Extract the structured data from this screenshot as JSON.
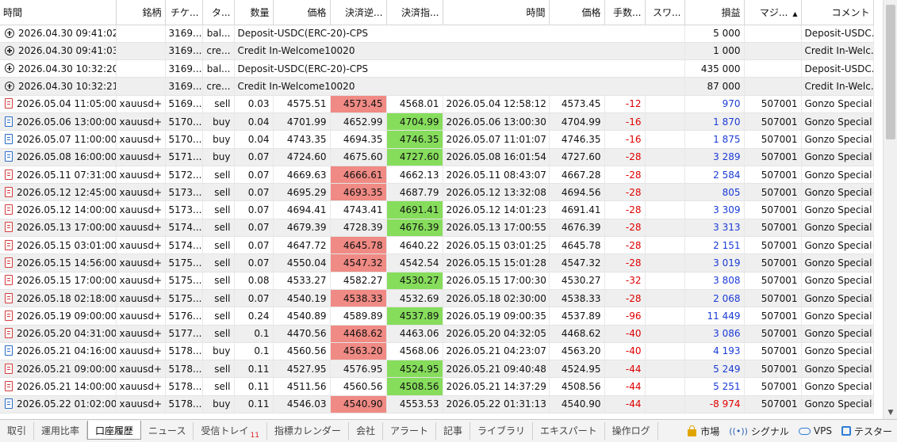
{
  "columns": [
    "時間",
    "銘柄",
    "チケ...",
    "タ...",
    "数量",
    "価格",
    "決済逆...",
    "決済指...",
    "時間",
    "価格",
    "手数...",
    "スワ...",
    "損益",
    "マジ...",
    "コメント"
  ],
  "sort_arrow": "▲",
  "rows": [
    {
      "icon": "plus",
      "time": "2026.04.30 09:41:02",
      "symbol": "",
      "ticket": "3169...",
      "type": "bal...",
      "volume": "Deposit-USDC(ERC-20)-CPS",
      "price": "",
      "sl": "",
      "tp": "",
      "time2": "",
      "price2": "",
      "fee": "",
      "swap": "",
      "profit": "5 000",
      "magic": "",
      "comment": "Deposit-USDC..."
    },
    {
      "icon": "plus",
      "time": "2026.04.30 09:41:03",
      "symbol": "",
      "ticket": "3169...",
      "type": "cre...",
      "volume": "Credit In-Welcome10020",
      "price": "",
      "sl": "",
      "tp": "",
      "time2": "",
      "price2": "",
      "fee": "",
      "swap": "",
      "profit": "1 000",
      "magic": "",
      "comment": "Credit In-Welc..."
    },
    {
      "icon": "plus",
      "time": "2026.04.30 10:32:20",
      "symbol": "",
      "ticket": "3169...",
      "type": "bal...",
      "volume": "Deposit-USDC(ERC-20)-CPS",
      "price": "",
      "sl": "",
      "tp": "",
      "time2": "",
      "price2": "",
      "fee": "",
      "swap": "",
      "profit": "435 000",
      "magic": "",
      "comment": "Deposit-USDC..."
    },
    {
      "icon": "plus",
      "time": "2026.04.30 10:32:21",
      "symbol": "",
      "ticket": "3169...",
      "type": "cre...",
      "volume": "Credit In-Welcome10020",
      "price": "",
      "sl": "",
      "tp": "",
      "time2": "",
      "price2": "",
      "fee": "",
      "swap": "",
      "profit": "87 000",
      "magic": "",
      "comment": "Credit In-Welc..."
    },
    {
      "icon": "sell",
      "time": "2026.05.04 11:05:00",
      "symbol": "xauusd+",
      "ticket": "5169...",
      "type": "sell",
      "volume": "0.03",
      "price": "4575.51",
      "sl": "4573.45",
      "tp": "4568.01",
      "time2": "2026.05.04 12:58:12",
      "price2": "4573.45",
      "fee": "-12",
      "swap": "",
      "profit": "970",
      "magic": "507001",
      "comment": "Gonzo Special+",
      "hit": "sl"
    },
    {
      "icon": "buy",
      "time": "2026.05.06 13:00:00",
      "symbol": "xauusd+",
      "ticket": "5170...",
      "type": "buy",
      "volume": "0.04",
      "price": "4701.99",
      "sl": "4652.99",
      "tp": "4704.99",
      "time2": "2026.05.06 13:00:30",
      "price2": "4704.99",
      "fee": "-16",
      "swap": "",
      "profit": "1 870",
      "magic": "507001",
      "comment": "Gonzo Special",
      "hit": "tp"
    },
    {
      "icon": "buy",
      "time": "2026.05.07 11:00:00",
      "symbol": "xauusd+",
      "ticket": "5170...",
      "type": "buy",
      "volume": "0.04",
      "price": "4743.35",
      "sl": "4694.35",
      "tp": "4746.35",
      "time2": "2026.05.07 11:01:07",
      "price2": "4746.35",
      "fee": "-16",
      "swap": "",
      "profit": "1 875",
      "magic": "507001",
      "comment": "Gonzo Special",
      "hit": "tp"
    },
    {
      "icon": "buy",
      "time": "2026.05.08 16:00:00",
      "symbol": "xauusd+",
      "ticket": "5171...",
      "type": "buy",
      "volume": "0.07",
      "price": "4724.60",
      "sl": "4675.60",
      "tp": "4727.60",
      "time2": "2026.05.08 16:01:54",
      "price2": "4727.60",
      "fee": "-28",
      "swap": "",
      "profit": "3 289",
      "magic": "507001",
      "comment": "Gonzo Special",
      "hit": "tp"
    },
    {
      "icon": "sell",
      "time": "2026.05.11 07:31:00",
      "symbol": "xauusd+",
      "ticket": "5172...",
      "type": "sell",
      "volume": "0.07",
      "price": "4669.63",
      "sl": "4666.61",
      "tp": "4662.13",
      "time2": "2026.05.11 08:43:07",
      "price2": "4667.28",
      "fee": "-28",
      "swap": "",
      "profit": "2 584",
      "magic": "507001",
      "comment": "Gonzo Special+",
      "hit": "sl"
    },
    {
      "icon": "sell",
      "time": "2026.05.12 12:45:00",
      "symbol": "xauusd+",
      "ticket": "5173...",
      "type": "sell",
      "volume": "0.07",
      "price": "4695.29",
      "sl": "4693.35",
      "tp": "4687.79",
      "time2": "2026.05.12 13:32:08",
      "price2": "4694.56",
      "fee": "-28",
      "swap": "",
      "profit": "805",
      "magic": "507001",
      "comment": "Gonzo Special+",
      "hit": "sl"
    },
    {
      "icon": "sell",
      "time": "2026.05.12 14:00:00",
      "symbol": "xauusd+",
      "ticket": "5173...",
      "type": "sell",
      "volume": "0.07",
      "price": "4694.41",
      "sl": "4743.41",
      "tp": "4691.41",
      "time2": "2026.05.12 14:01:23",
      "price2": "4691.41",
      "fee": "-28",
      "swap": "",
      "profit": "3 309",
      "magic": "507001",
      "comment": "Gonzo Special",
      "hit": "tp"
    },
    {
      "icon": "sell",
      "time": "2026.05.13 17:00:00",
      "symbol": "xauusd+",
      "ticket": "5174...",
      "type": "sell",
      "volume": "0.07",
      "price": "4679.39",
      "sl": "4728.39",
      "tp": "4676.39",
      "time2": "2026.05.13 17:00:55",
      "price2": "4676.39",
      "fee": "-28",
      "swap": "",
      "profit": "3 313",
      "magic": "507001",
      "comment": "Gonzo Special",
      "hit": "tp"
    },
    {
      "icon": "sell",
      "time": "2026.05.15 03:01:00",
      "symbol": "xauusd+",
      "ticket": "5174...",
      "type": "sell",
      "volume": "0.07",
      "price": "4647.72",
      "sl": "4645.78",
      "tp": "4640.22",
      "time2": "2026.05.15 03:01:25",
      "price2": "4645.78",
      "fee": "-28",
      "swap": "",
      "profit": "2 151",
      "magic": "507001",
      "comment": "Gonzo Special+",
      "hit": "sl"
    },
    {
      "icon": "sell",
      "time": "2026.05.15 14:56:00",
      "symbol": "xauusd+",
      "ticket": "5175...",
      "type": "sell",
      "volume": "0.07",
      "price": "4550.04",
      "sl": "4547.32",
      "tp": "4542.54",
      "time2": "2026.05.15 15:01:28",
      "price2": "4547.32",
      "fee": "-28",
      "swap": "",
      "profit": "3 019",
      "magic": "507001",
      "comment": "Gonzo Special+",
      "hit": "sl"
    },
    {
      "icon": "sell",
      "time": "2026.05.15 17:00:00",
      "symbol": "xauusd+",
      "ticket": "5175...",
      "type": "sell",
      "volume": "0.08",
      "price": "4533.27",
      "sl": "4582.27",
      "tp": "4530.27",
      "time2": "2026.05.15 17:00:30",
      "price2": "4530.27",
      "fee": "-32",
      "swap": "",
      "profit": "3 808",
      "magic": "507001",
      "comment": "Gonzo Special",
      "hit": "tp"
    },
    {
      "icon": "sell",
      "time": "2026.05.18 02:18:00",
      "symbol": "xauusd+",
      "ticket": "5175...",
      "type": "sell",
      "volume": "0.07",
      "price": "4540.19",
      "sl": "4538.33",
      "tp": "4532.69",
      "time2": "2026.05.18 02:30:00",
      "price2": "4538.33",
      "fee": "-28",
      "swap": "",
      "profit": "2 068",
      "magic": "507001",
      "comment": "Gonzo Special+",
      "hit": "sl"
    },
    {
      "icon": "sell",
      "time": "2026.05.19 09:00:00",
      "symbol": "xauusd+",
      "ticket": "5176...",
      "type": "sell",
      "volume": "0.24",
      "price": "4540.89",
      "sl": "4589.89",
      "tp": "4537.89",
      "time2": "2026.05.19 09:00:35",
      "price2": "4537.89",
      "fee": "-96",
      "swap": "",
      "profit": "11 449",
      "magic": "507001",
      "comment": "Gonzo Special",
      "hit": "tp"
    },
    {
      "icon": "sell",
      "time": "2026.05.20 04:31:00",
      "symbol": "xauusd+",
      "ticket": "5177...",
      "type": "sell",
      "volume": "0.1",
      "price": "4470.56",
      "sl": "4468.62",
      "tp": "4463.06",
      "time2": "2026.05.20 04:32:05",
      "price2": "4468.62",
      "fee": "-40",
      "swap": "",
      "profit": "3 086",
      "magic": "507001",
      "comment": "Gonzo Special+",
      "hit": "sl"
    },
    {
      "icon": "buy",
      "time": "2026.05.21 04:16:00",
      "symbol": "xauusd+",
      "ticket": "5178...",
      "type": "buy",
      "volume": "0.1",
      "price": "4560.56",
      "sl": "4563.20",
      "tp": "4568.06",
      "time2": "2026.05.21 04:23:07",
      "price2": "4563.20",
      "fee": "-40",
      "swap": "",
      "profit": "4 193",
      "magic": "507001",
      "comment": "Gonzo Special+",
      "hit": "sl"
    },
    {
      "icon": "sell",
      "time": "2026.05.21 09:00:00",
      "symbol": "xauusd+",
      "ticket": "5178...",
      "type": "sell",
      "volume": "0.11",
      "price": "4527.95",
      "sl": "4576.95",
      "tp": "4524.95",
      "time2": "2026.05.21 09:40:48",
      "price2": "4524.95",
      "fee": "-44",
      "swap": "",
      "profit": "5 249",
      "magic": "507001",
      "comment": "Gonzo Special",
      "hit": "tp"
    },
    {
      "icon": "sell",
      "time": "2026.05.21 14:00:00",
      "symbol": "xauusd+",
      "ticket": "5178...",
      "type": "sell",
      "volume": "0.11",
      "price": "4511.56",
      "sl": "4560.56",
      "tp": "4508.56",
      "time2": "2026.05.21 14:37:29",
      "price2": "4508.56",
      "fee": "-44",
      "swap": "",
      "profit": "5 251",
      "magic": "507001",
      "comment": "Gonzo Special",
      "hit": "tp"
    },
    {
      "icon": "buy",
      "time": "2026.05.22 01:02:00",
      "symbol": "xauusd+",
      "ticket": "5178...",
      "type": "buy",
      "volume": "0.11",
      "price": "4546.03",
      "sl": "4540.90",
      "tp": "4553.53",
      "time2": "2026.05.22 01:31:13",
      "price2": "4540.90",
      "fee": "-44",
      "swap": "",
      "profit": "-8 974",
      "magic": "507001",
      "comment": "Gonzo Special+",
      "hit": "sl"
    }
  ],
  "tabs": [
    {
      "label": "取引",
      "active": false
    },
    {
      "label": "運用比率",
      "active": false
    },
    {
      "label": "口座履歴",
      "active": true
    },
    {
      "label": "ニュース",
      "active": false
    },
    {
      "label": "受信トレイ",
      "active": false,
      "badge": "11"
    },
    {
      "label": "指標カレンダー",
      "active": false
    },
    {
      "label": "会社",
      "active": false
    },
    {
      "label": "アラート",
      "active": false
    },
    {
      "label": "記事",
      "active": false
    },
    {
      "label": "ライブラリ",
      "active": false
    },
    {
      "label": "エキスパート",
      "active": false
    },
    {
      "label": "操作ログ",
      "active": false
    }
  ],
  "tools": {
    "market": "市場",
    "signals": "シグナル",
    "vps": "VPS",
    "tester": "テスター"
  },
  "colors": {
    "sl_hit": "#f08a84",
    "tp_hit": "#86dd5c",
    "negative": "#e00000",
    "positive": "#1a3bd6"
  }
}
